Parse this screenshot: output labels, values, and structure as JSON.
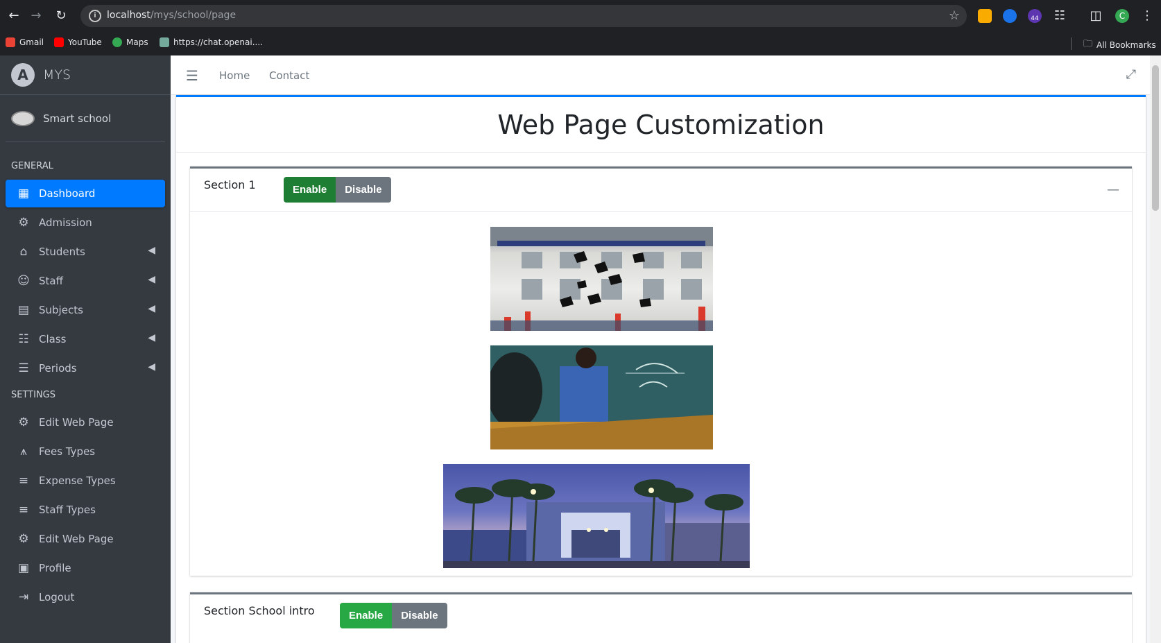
{
  "browser": {
    "url_host": "localhost",
    "url_path": "/mys/school/page",
    "extension_badge": "44",
    "profile_initial": "C",
    "bookmarks": [
      {
        "label": "Gmail",
        "color": "#ea4335"
      },
      {
        "label": "YouTube",
        "color": "#ff0000"
      },
      {
        "label": "Maps",
        "color": "#34a853"
      },
      {
        "label": "https://chat.openai....",
        "color": "#74aa9c"
      }
    ],
    "all_bookmarks": "All Bookmarks"
  },
  "sidebar": {
    "brand": "MYS",
    "user": "Smart school",
    "sections": [
      {
        "header": "GENERAL",
        "items": [
          {
            "label": "Dashboard",
            "icon": "dashboard-icon",
            "active": true,
            "caret": false
          },
          {
            "label": "Admission",
            "icon": "gear-icon",
            "active": false,
            "caret": false
          },
          {
            "label": "Students",
            "icon": "graduation-cap-icon",
            "active": false,
            "caret": true
          },
          {
            "label": "Staff",
            "icon": "users-icon",
            "active": false,
            "caret": true
          },
          {
            "label": "Subjects",
            "icon": "book-reader-icon",
            "active": false,
            "caret": true
          },
          {
            "label": "Class",
            "icon": "chalkboard-icon",
            "active": false,
            "caret": true
          },
          {
            "label": "Periods",
            "icon": "list-icon",
            "active": false,
            "caret": true
          }
        ]
      },
      {
        "header": "SETTINGS",
        "items": [
          {
            "label": "Edit Web Page",
            "icon": "gear-icon",
            "active": false,
            "caret": false
          },
          {
            "label": "Fees Types",
            "icon": "filter-dollar-icon",
            "active": false,
            "caret": false
          },
          {
            "label": "Expense Types",
            "icon": "receipt-icon",
            "active": false,
            "caret": false
          },
          {
            "label": "Staff Types",
            "icon": "receipt-icon",
            "active": false,
            "caret": false
          },
          {
            "label": "Edit Web Page",
            "icon": "gear-icon",
            "active": false,
            "caret": false
          },
          {
            "label": "Profile",
            "icon": "id-badge-icon",
            "active": false,
            "caret": false
          },
          {
            "label": "Logout",
            "icon": "sign-out-icon",
            "active": false,
            "caret": false
          }
        ]
      }
    ]
  },
  "navbar": {
    "home": "Home",
    "contact": "Contact"
  },
  "page": {
    "title": "Web Page Customization"
  },
  "sections": [
    {
      "label": "Section 1",
      "enable": "Enable",
      "disable": "Disable"
    },
    {
      "label": "Section School intro",
      "enable": "Enable",
      "disable": "Disable"
    }
  ],
  "colors": {
    "primary": "#007bff",
    "success": "#28a745",
    "secondary": "#6c757d",
    "sidebar_bg": "#343a40"
  }
}
